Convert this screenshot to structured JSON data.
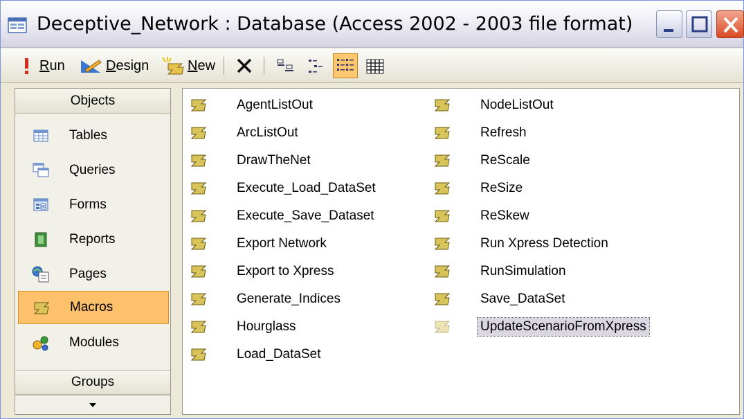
{
  "window": {
    "title": "Deceptive_Network : Database (Access 2002 - 2003 file format)"
  },
  "toolbar": {
    "run_label_u": "R",
    "run_label_rest": "un",
    "design_label_u": "D",
    "design_label_rest": "esign",
    "new_label_u": "N",
    "new_label_rest": "ew",
    "active_view": "list"
  },
  "objects_pane": {
    "header": "Objects",
    "items": [
      {
        "label": "Tables",
        "icon": "table-icon"
      },
      {
        "label": "Queries",
        "icon": "query-icon"
      },
      {
        "label": "Forms",
        "icon": "form-icon"
      },
      {
        "label": "Reports",
        "icon": "report-icon"
      },
      {
        "label": "Pages",
        "icon": "page-icon"
      },
      {
        "label": "Macros",
        "icon": "macro-icon",
        "selected": true
      },
      {
        "label": "Modules",
        "icon": "module-icon"
      }
    ],
    "groups_header": "Groups"
  },
  "macros": {
    "column1": [
      "AgentListOut",
      "ArcListOut",
      "DrawTheNet",
      "Execute_Load_DataSet",
      "Execute_Save_Dataset",
      "Export Network",
      "Export to Xpress",
      "Generate_Indices",
      "Hourglass",
      "Load_DataSet"
    ],
    "column2": [
      "NodeListOut",
      "Refresh",
      "ReScale",
      "ReSize",
      "ReSkew",
      "Run Xpress Detection",
      "RunSimulation",
      "Save_DataSet",
      "UpdateScenarioFromXpress"
    ],
    "focused": "UpdateScenarioFromXpress"
  },
  "colors": {
    "selection": "#fdc06b",
    "close_button": "#d94a22"
  }
}
